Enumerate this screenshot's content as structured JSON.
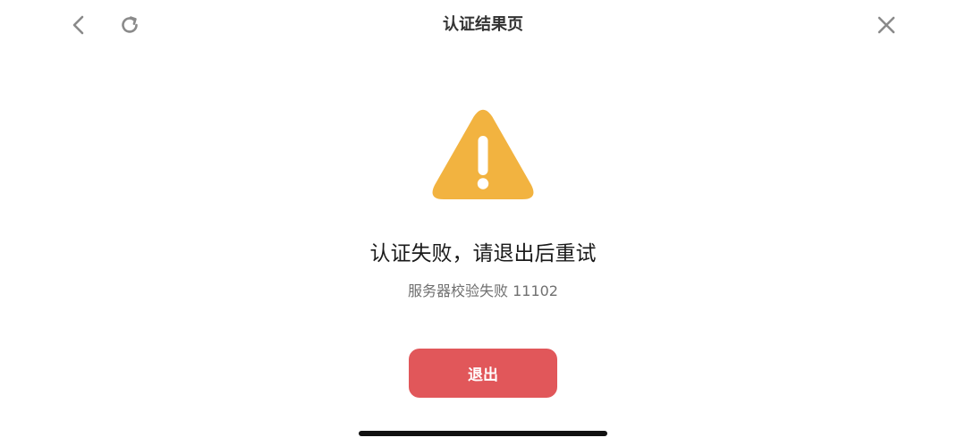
{
  "nav": {
    "title": "认证结果页",
    "back_icon": "chevron-left-icon",
    "refresh_icon": "refresh-icon",
    "close_icon": "close-icon"
  },
  "result": {
    "status": "warning",
    "icon": "warning-triangle-icon",
    "icon_color": "#f2b340",
    "title": "认证失败，请退出后重试",
    "subtitle": "服务器校验失败 11102"
  },
  "actions": {
    "exit_label": "退出",
    "exit_color": "#e1575a"
  }
}
